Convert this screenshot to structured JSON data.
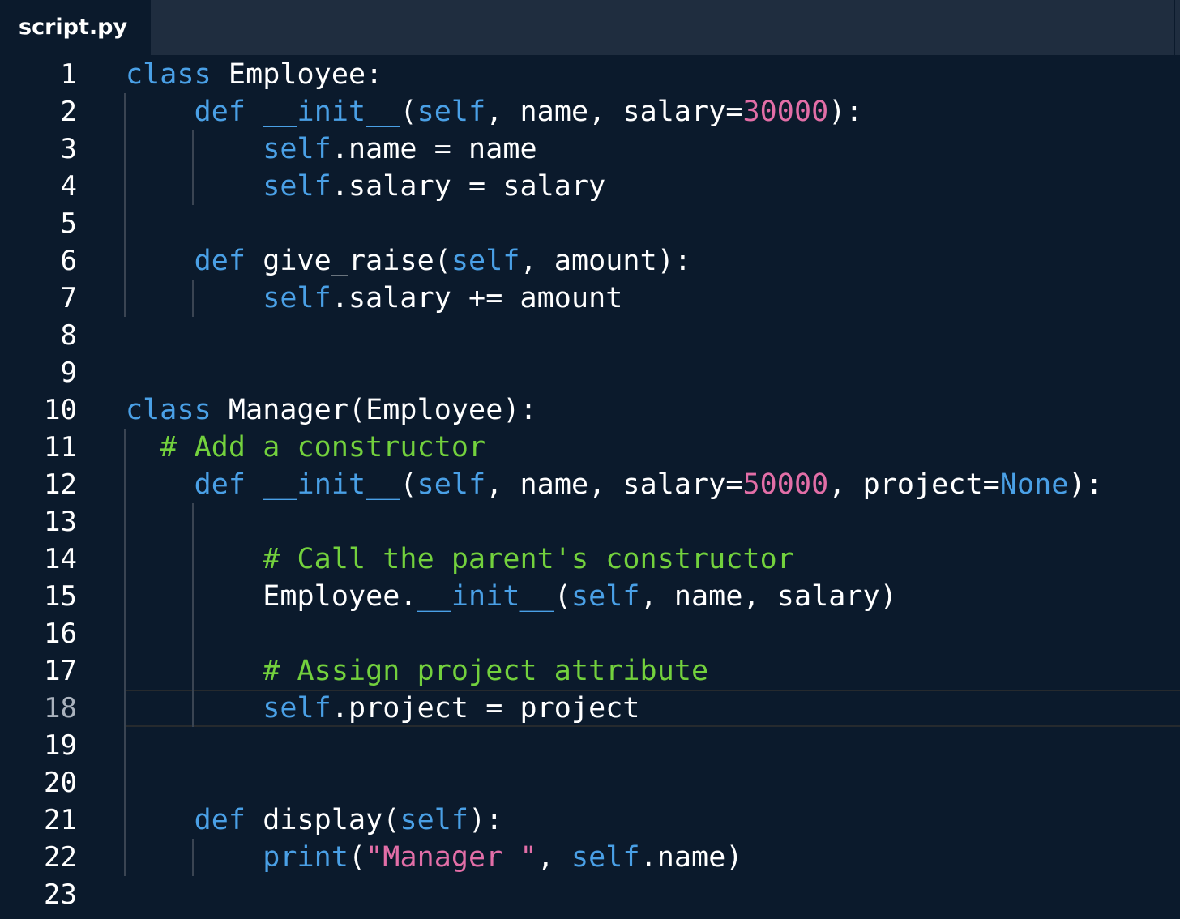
{
  "tab": {
    "filename": "script.py"
  },
  "editor": {
    "active_line": 18,
    "colors": {
      "background": "#0b1a2c",
      "tabbar": "#1f2d3f",
      "keyword": "#4aa0e6",
      "number": "#e26ea7",
      "string": "#e26ea7",
      "comment": "#73d13d",
      "text": "#ffffff"
    },
    "lines": [
      {
        "n": "1",
        "tokens": [
          [
            "class",
            "kw"
          ],
          [
            " Employee:",
            ""
          ]
        ]
      },
      {
        "n": "2",
        "tokens": [
          [
            "    ",
            ""
          ],
          [
            "def",
            "kw"
          ],
          [
            " ",
            ""
          ],
          [
            "__init__",
            "kw"
          ],
          [
            "(",
            ""
          ],
          [
            "self",
            "kw"
          ],
          [
            ", name, salary=",
            ""
          ],
          [
            "30000",
            "num"
          ],
          [
            "):",
            ""
          ]
        ]
      },
      {
        "n": "3",
        "tokens": [
          [
            "        ",
            ""
          ],
          [
            "self",
            "kw"
          ],
          [
            ".name = name",
            ""
          ]
        ]
      },
      {
        "n": "4",
        "tokens": [
          [
            "        ",
            ""
          ],
          [
            "self",
            "kw"
          ],
          [
            ".salary = salary",
            ""
          ]
        ]
      },
      {
        "n": "5",
        "tokens": []
      },
      {
        "n": "6",
        "tokens": [
          [
            "    ",
            ""
          ],
          [
            "def",
            "kw"
          ],
          [
            " give_raise(",
            ""
          ],
          [
            "self",
            "kw"
          ],
          [
            ", amount):",
            ""
          ]
        ]
      },
      {
        "n": "7",
        "tokens": [
          [
            "        ",
            ""
          ],
          [
            "self",
            "kw"
          ],
          [
            ".salary += amount",
            ""
          ]
        ]
      },
      {
        "n": "8",
        "tokens": []
      },
      {
        "n": "9",
        "tokens": []
      },
      {
        "n": "10",
        "tokens": [
          [
            "class",
            "kw"
          ],
          [
            " Manager(Employee):",
            ""
          ]
        ]
      },
      {
        "n": "11",
        "tokens": [
          [
            "  ",
            ""
          ],
          [
            "# Add a constructor",
            "cmt"
          ]
        ]
      },
      {
        "n": "12",
        "tokens": [
          [
            "    ",
            ""
          ],
          [
            "def",
            "kw"
          ],
          [
            " ",
            ""
          ],
          [
            "__init__",
            "kw"
          ],
          [
            "(",
            ""
          ],
          [
            "self",
            "kw"
          ],
          [
            ", name, salary=",
            ""
          ],
          [
            "50000",
            "num"
          ],
          [
            ", project=",
            ""
          ],
          [
            "None",
            "kw"
          ],
          [
            "):",
            ""
          ]
        ]
      },
      {
        "n": "13",
        "tokens": []
      },
      {
        "n": "14",
        "tokens": [
          [
            "        ",
            ""
          ],
          [
            "# Call the parent's constructor",
            "cmt"
          ]
        ]
      },
      {
        "n": "15",
        "tokens": [
          [
            "        Employee.",
            ""
          ],
          [
            "__init__",
            "kw"
          ],
          [
            "(",
            ""
          ],
          [
            "self",
            "kw"
          ],
          [
            ", name, salary)",
            ""
          ]
        ]
      },
      {
        "n": "16",
        "tokens": []
      },
      {
        "n": "17",
        "tokens": [
          [
            "        ",
            ""
          ],
          [
            "# Assign project attribute",
            "cmt"
          ]
        ]
      },
      {
        "n": "18",
        "tokens": [
          [
            "        ",
            ""
          ],
          [
            "self",
            "kw"
          ],
          [
            ".project = project",
            ""
          ]
        ]
      },
      {
        "n": "19",
        "tokens": []
      },
      {
        "n": "20",
        "tokens": []
      },
      {
        "n": "21",
        "tokens": [
          [
            "    ",
            ""
          ],
          [
            "def",
            "kw"
          ],
          [
            " display(",
            ""
          ],
          [
            "self",
            "kw"
          ],
          [
            "):",
            ""
          ]
        ]
      },
      {
        "n": "22",
        "tokens": [
          [
            "        ",
            ""
          ],
          [
            "print",
            "kw"
          ],
          [
            "(",
            ""
          ],
          [
            "\"Manager \"",
            "str"
          ],
          [
            ", ",
            ""
          ],
          [
            "self",
            "kw"
          ],
          [
            ".name)",
            ""
          ]
        ]
      },
      {
        "n": "23",
        "tokens": []
      }
    ]
  }
}
